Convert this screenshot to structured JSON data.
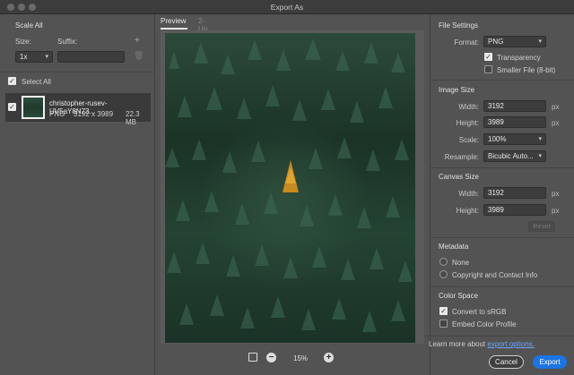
{
  "window": {
    "title": "Export As"
  },
  "left": {
    "scale_all": "Scale All",
    "size_label": "Size:",
    "suffix_label": "Suffix:",
    "add_icon": "plus-icon",
    "delete_icon": "trash-icon",
    "size_value": "1x",
    "suffix_value": "",
    "select_all": "Select All",
    "asset": {
      "name": "christopher-rusev-UV5aY8N73...",
      "format": "PNG",
      "dimensions": "3192 x 3989",
      "filesize": "22.3 MB"
    }
  },
  "center": {
    "tabs": [
      "Preview",
      "2-Up"
    ],
    "zoom": "15%"
  },
  "right": {
    "file_settings": "File Settings",
    "format_label": "Format:",
    "format_value": "PNG",
    "transparency": "Transparency",
    "smaller_file": "Smaller File (8-bit)",
    "image_size": "Image Size",
    "width_label": "Width:",
    "width_value": "3192",
    "height_label": "Height:",
    "height_value": "3989",
    "unit": "px",
    "scale_label": "Scale:",
    "scale_value": "100%",
    "resample_label": "Resample:",
    "resample_value": "Bicubic Auto...",
    "canvas_size": "Canvas Size",
    "canvas_width_label": "Width:",
    "canvas_width": "3192",
    "canvas_height_label": "Height:",
    "canvas_height": "3989",
    "reset": "Reset",
    "metadata": "Metadata",
    "meta_none": "None",
    "meta_copyright": "Copyright and Contact Info",
    "color_space": "Color Space",
    "convert_srgb": "Convert to sRGB",
    "embed_profile": "Embed Color Profile",
    "learn_more": "Learn more about",
    "export_options": "export options.",
    "cancel": "Cancel",
    "export": "Export"
  }
}
